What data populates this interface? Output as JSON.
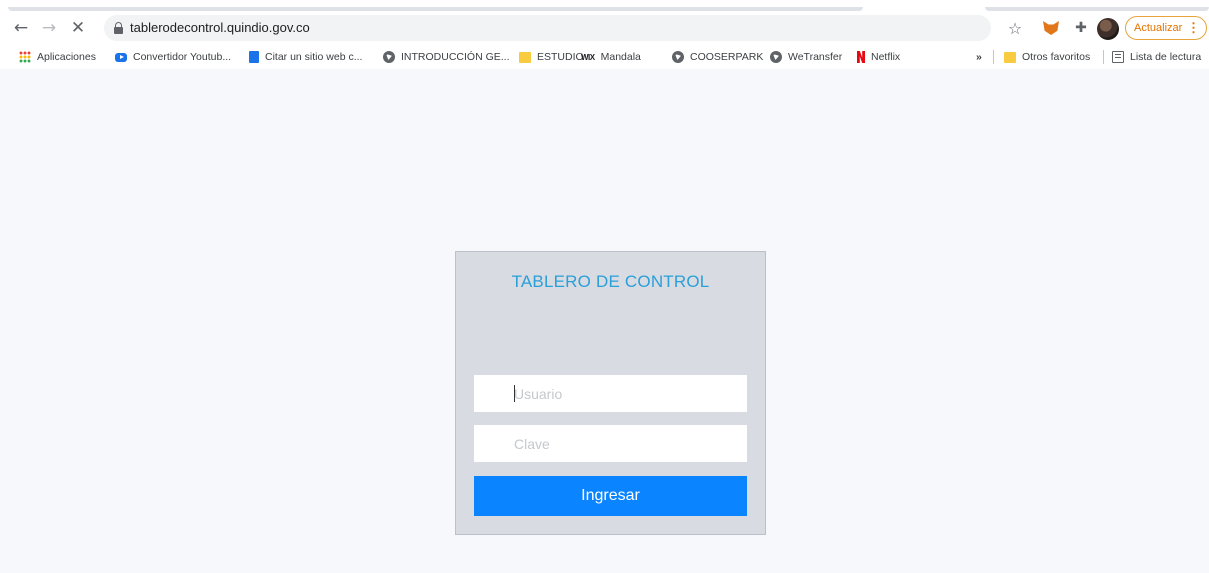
{
  "browser": {
    "url": "tablerodecontrol.quindio.gov.co",
    "update_label": "Actualizar",
    "update_menu": "⋮",
    "bookmarks": [
      {
        "label": "Aplicaciones",
        "icon": "apps-grid-icon"
      },
      {
        "label": "Convertidor Youtub...",
        "icon": "youtube-icon"
      },
      {
        "label": "Citar un sitio web c...",
        "icon": "document-icon"
      },
      {
        "label": "INTRODUCCIÓN GE...",
        "icon": "globe-icon"
      },
      {
        "label": "ESTUDIO",
        "icon": "folder-icon"
      },
      {
        "label": "Mandala",
        "icon": "wix-icon"
      },
      {
        "label": "COOSERPARK",
        "icon": "globe-icon"
      },
      {
        "label": "WeTransfer",
        "icon": "globe-icon"
      },
      {
        "label": "Netflix",
        "icon": "netflix-icon"
      }
    ],
    "bookmarks_overflow": "»",
    "other_bookmarks": "Otros favoritos",
    "reading_list": "Lista de lectura",
    "wix_mark": "WIX",
    "accent_color": "#e37400"
  },
  "login": {
    "title": "TABLERO DE CONTROL",
    "username_placeholder": "Usuario",
    "password_placeholder": "Clave",
    "submit_label": "Ingresar",
    "title_color": "#2a9fd8",
    "button_color": "#0a84ff",
    "card_color": "#d8dbe2"
  }
}
